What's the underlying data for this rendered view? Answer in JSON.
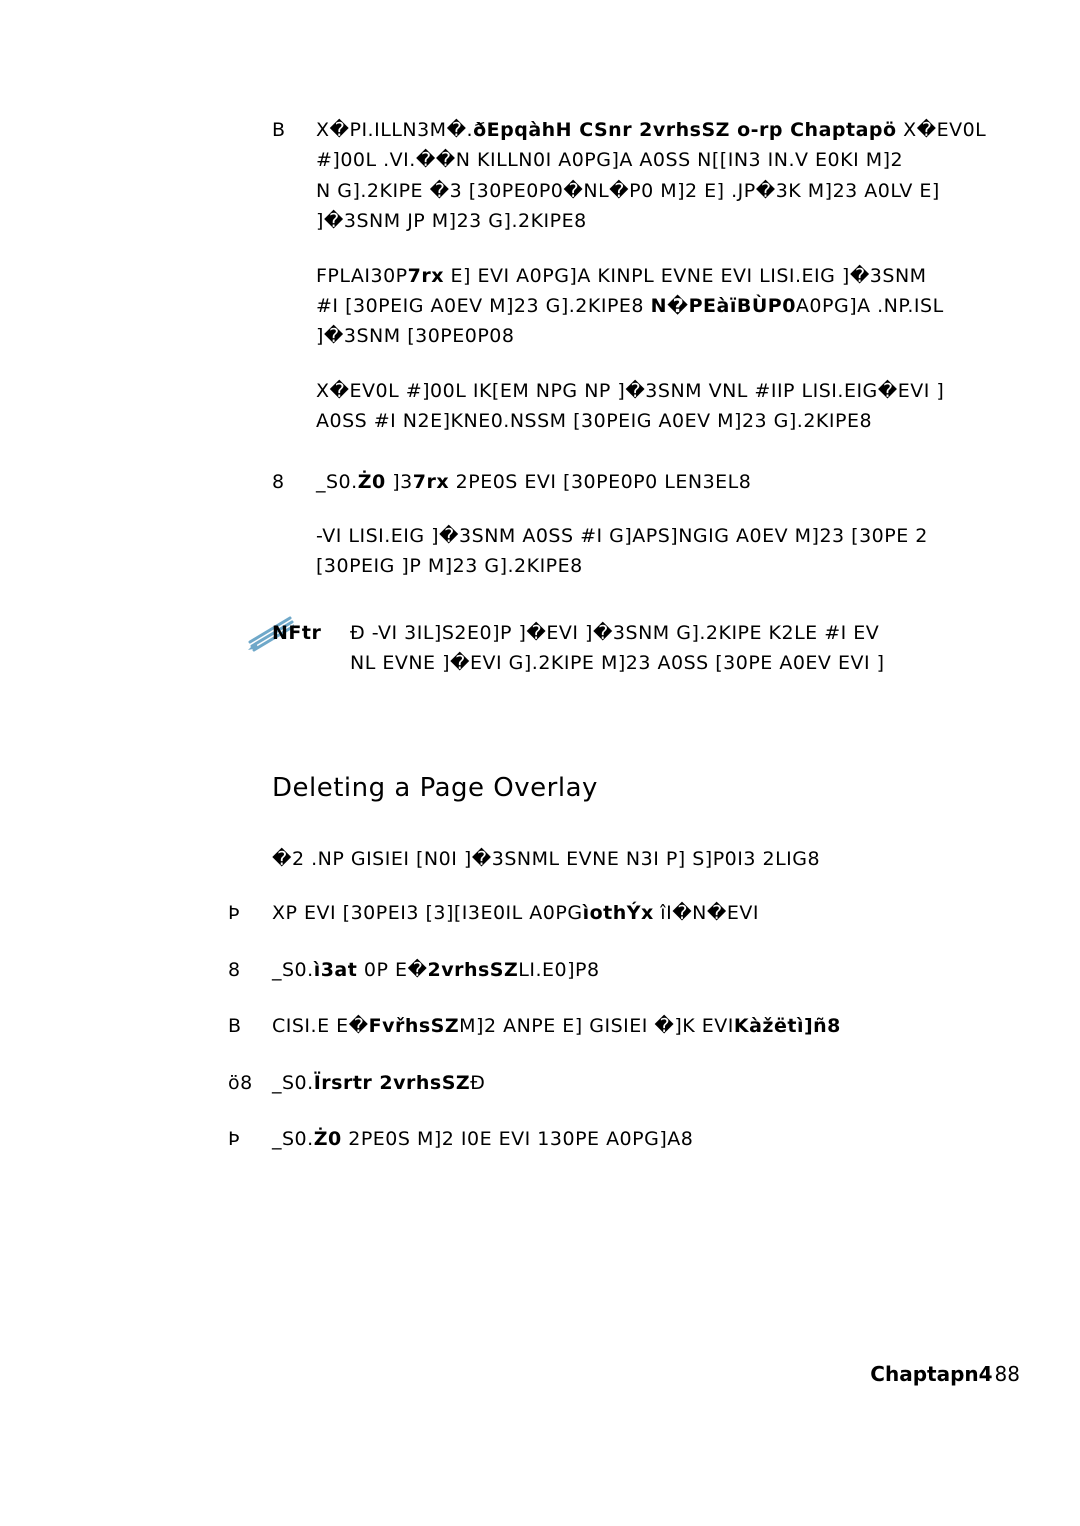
{
  "block1": {
    "item3": {
      "num": "B",
      "para1_pre": "X�PI.ILLN3M�.",
      "para1_bold": "ðEpqàhH CSnr 2vrhsSZ o-rp Chaptapö",
      "para1_post": " X�EV0L",
      "para1_l2": "#]00L .VI.��N KILLN0I A0PG]A A0SS N[[IN3 IN.V E0KI M]2",
      "para1_l3": "N G].2KIPE �3 [30PE0P0�NL�P0 M]2 E] .JP�3K M]23 A0LV E]",
      "para1_l4": "]�3SNM JP M]23 G].2KIPE8",
      "para2_l1_pre": "FPLAI30P",
      "para2_l1_bold": "7rx",
      "para2_l1_post": " E] EVI A0PG]A KINPL EVNE EVI LISI.EIG ]�3SNM",
      "para2_l2_pre": "#I [30PEIG A0EV M]23 G].2KIPE8 ",
      "para2_l2_bold": "N�PEàïBÙP0",
      "para2_l2_post": "A0PG]A .NP.ISL",
      "para2_l3": "]�3SNM [30PE0P08",
      "para3_l1": "X�EV0L #]00L IK[EM NPG NP ]�3SNM VNL #IIP LISI.EIG�EVI ]",
      "para3_l2": "A0SS #I N2E]KNE0.NSSM [30PEIG A0EV M]23 G].2KIPE8"
    },
    "item4": {
      "num": "8",
      "l1_pre": "_S0.",
      "l1_bold1": "Ż0",
      "l1_mid": " ]3",
      "l1_bold2": "7rx",
      "l1_post": " 2PE0S EVI [30PE0P0 LEN3EL8",
      "p2_l1": "-VI LISI.EIG ]�3SNM A0SS #I G]APS]NGIG A0EV M]23 [30PE 2",
      "p2_l2": "[30PEIG ]P M]23 G].2KIPE8"
    },
    "note": {
      "label": "NFtr",
      "l1": "Ð -VI 3IL]S2E0]P ]�EVI ]�3SNM G].2KIPE K2LE #I EV",
      "l2": "NL EVNE ]�EVI G].2KIPE M]23 A0SS [30PE A0EV EVI ]"
    }
  },
  "section_heading": "Deleting a Page Overlay",
  "intro": "�2 .NP GISIEI [N0I ]�3SNML EVNE N3I P] S]P0I3 2LIG8",
  "steps": {
    "s1": {
      "num": "Þ",
      "pre": "XP EVI [30PEI3 [3][I3E0IL A0PG",
      "bold": "ìothÝx",
      "mid": " îI�N�EVI"
    },
    "s2": {
      "num": "8",
      "pre": "_S0.",
      "bold1": "ì3at",
      "mid1": " 0P E�",
      "bold2": "2vrhsSZ",
      "post": "LI.E0]P8"
    },
    "s3": {
      "num": "B",
      "pre": "CISI.E E�",
      "bold1": "FvřhsSZ",
      "mid": "M]2 ANPE E] GISIEI �]K EVI",
      "bold2": "Kàžëtì]ñ8"
    },
    "s4": {
      "num": "ö8",
      "pre": "_S0.",
      "bold": "Ïrsrtr 2vrhsSZ",
      "post": "Ð"
    },
    "s5": {
      "num": "Þ",
      "pre": "_S0.",
      "bold": "Ż0",
      "post": " 2PE0S M]2 I0E EVI 130PE A0PG]A8"
    }
  },
  "footer": {
    "chapter": "Chaptapn",
    "page": "4",
    "pagenum": "88"
  }
}
